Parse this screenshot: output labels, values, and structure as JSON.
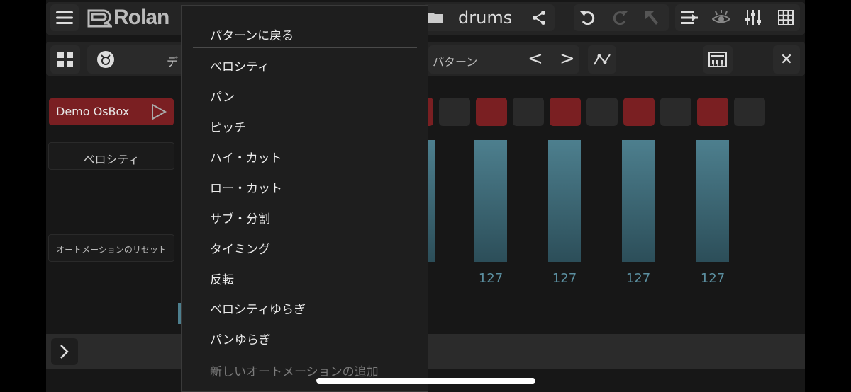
{
  "header": {
    "logo": "Rolan",
    "project_name": "drums",
    "icons": [
      "menu-icon",
      "folder-icon",
      "share-icon",
      "undo-icon",
      "redo-icon",
      "cursor-icon",
      "list-icon",
      "eye-icon",
      "mixer-icon",
      "grid-icon"
    ]
  },
  "toolbar": {
    "instrument_text": "デ",
    "pattern_label": "パターン",
    "prev": "<",
    "next": ">",
    "close": "✕"
  },
  "left": {
    "track_button": "Demo OsBox",
    "velocity_button": "ベロシティ",
    "reset_button": "オートメーションのリセット"
  },
  "steps": [
    true,
    false,
    true,
    false,
    true,
    false,
    true,
    false,
    true,
    false
  ],
  "velocity_values": [
    "127",
    "127",
    "127",
    "127"
  ],
  "menu": {
    "back": "パターンに戻る",
    "items": [
      "ベロシティ",
      "パン",
      "ピッチ",
      "ハイ・カット",
      "ロー・カット",
      "サブ・分割",
      "タイミング",
      "反転",
      "ベロシティゆらぎ",
      "パンゆらぎ"
    ],
    "add_new": "新しいオートメーションの追加"
  },
  "colors": {
    "accent_red": "#7a1f22",
    "bar_teal": "#4d7f8e",
    "value_text": "#5b8fa0"
  }
}
